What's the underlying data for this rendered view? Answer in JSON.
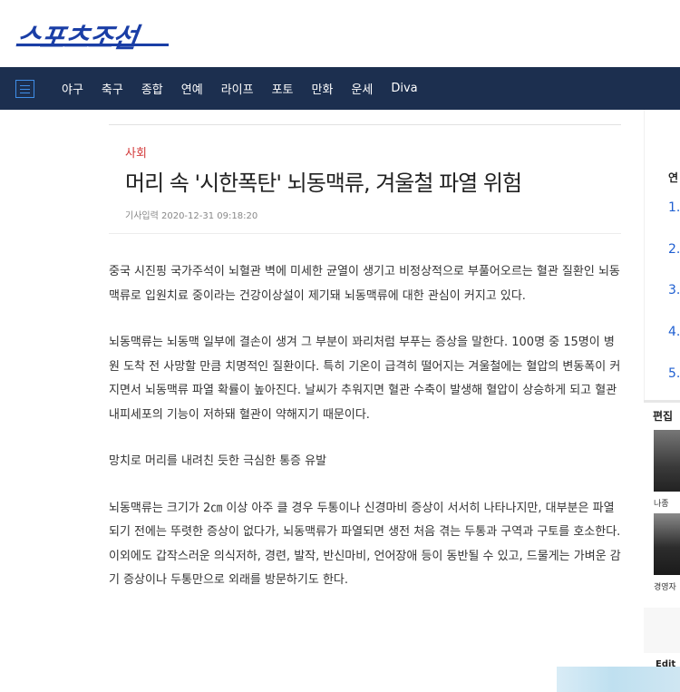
{
  "brand": {
    "logo_text": "스포츠조선"
  },
  "nav": {
    "menu_icon": "hamburger-menu-icon",
    "items": [
      "야구",
      "축구",
      "종합",
      "연예",
      "라이프",
      "포토",
      "만화",
      "운세",
      "Diva"
    ]
  },
  "article": {
    "category": "사회",
    "headline": "머리 속 '시한폭탄' 뇌동맥류, 겨울철 파열 위험",
    "dateline": "기사입력 2020-12-31 09:18:20",
    "paragraphs": [
      "중국 시진핑 국가주석이 뇌혈관 벽에 미세한 균열이 생기고 비정상적으로 부풀어오르는 혈관 질환인 뇌동맥류로 입원치료 중이라는 건강이상설이 제기돼 뇌동맥류에 대한 관심이 커지고 있다.",
      "뇌동맥류는 뇌동맥 일부에 결손이 생겨 그 부분이 꽈리처럼 부푸는 증상을 말한다. 100명 중 15명이 병원 도착 전 사망할 만큼 치명적인 질환이다. 특히 기온이 급격히 떨어지는 겨울철에는 혈압의 변동폭이 커지면서 뇌동맥류 파열 확률이 높아진다. 날씨가 추워지면 혈관 수축이 발생해 혈압이 상승하게 되고 혈관내피세포의 기능이 저하돼 혈관이 약해지기 때문이다.",
      "망치로 머리를 내려친 듯한 극심한 통증 유발",
      "뇌동맥류는 크기가 2㎝ 이상 아주 클 경우 두통이나 신경마비 증상이 서서히 나타나지만, 대부분은 파열되기 전에는 뚜렷한 증상이 없다가, 뇌동맥류가 파열되면 생전 처음 겪는 두통과 구역과 구토를 호소한다. 이외에도 갑작스러운 의식저하, 경련, 발작, 반신마비, 언어장애 등이 동반될 수 있고, 드물게는 가벼운 감기 증상이나 두통만으로 외래를 방문하기도 한다."
    ]
  },
  "sidebar": {
    "label": "연",
    "ranks": [
      "1.",
      "2.",
      "3.",
      "4.",
      "5."
    ],
    "section_title": "편집",
    "thumb_captions": [
      "나종",
      "경영자"
    ],
    "bottom_label": "Edit"
  },
  "colors": {
    "nav_bg": "#1c2f4f",
    "logo": "#1a3ea6",
    "category": "#d33a3a",
    "rank": "#1f5fd1"
  }
}
